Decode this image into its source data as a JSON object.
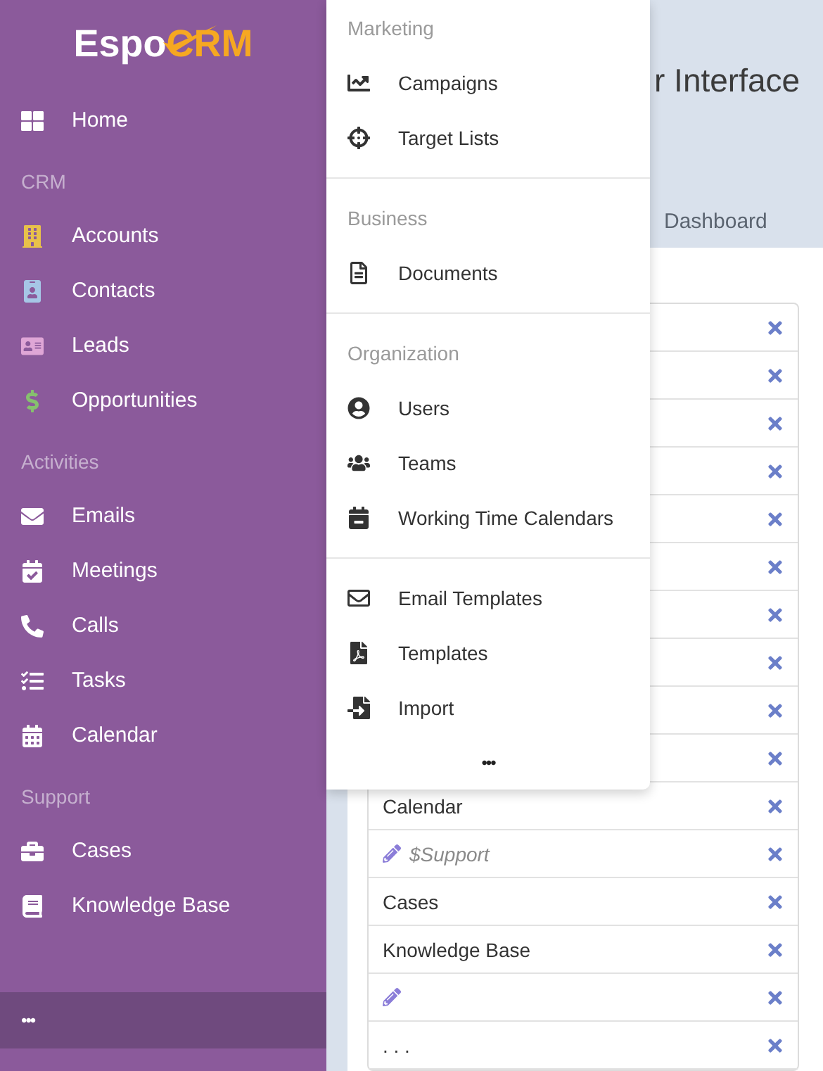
{
  "logo": {
    "text": "Espo",
    "accent": "CRM"
  },
  "sidebar": {
    "sections": [
      {
        "items": [
          {
            "label": "Home",
            "color": "#ffffff"
          }
        ]
      },
      {
        "header": "CRM",
        "items": [
          {
            "label": "Accounts",
            "color": "#e8c14a"
          },
          {
            "label": "Contacts",
            "color": "#a6c6e6"
          },
          {
            "label": "Leads",
            "color": "#dfa6d6"
          },
          {
            "label": "Opportunities",
            "color": "#86c06e"
          }
        ]
      },
      {
        "header": "Activities",
        "items": [
          {
            "label": "Emails",
            "color": "#ffffff"
          },
          {
            "label": "Meetings",
            "color": "#ffffff"
          },
          {
            "label": "Calls",
            "color": "#ffffff"
          },
          {
            "label": "Tasks",
            "color": "#ffffff"
          },
          {
            "label": "Calendar",
            "color": "#ffffff"
          }
        ]
      },
      {
        "header": "Support",
        "items": [
          {
            "label": "Cases",
            "color": "#ffffff"
          },
          {
            "label": "Knowledge Base",
            "color": "#ffffff"
          }
        ]
      }
    ],
    "more": "•••"
  },
  "menu": {
    "sections": [
      {
        "header": "Marketing",
        "items": [
          "Campaigns",
          "Target Lists"
        ]
      },
      {
        "header": "Business",
        "items": [
          "Documents"
        ]
      },
      {
        "header": "Organization",
        "items": [
          "Users",
          "Teams",
          "Working Time Calendars"
        ]
      },
      {
        "items": [
          "Email Templates",
          "Templates",
          "Import"
        ]
      }
    ],
    "more": "•••"
  },
  "header": {
    "title": "r Interface",
    "tab": "Dashboard"
  },
  "list": {
    "rows": [
      {
        "kind": "hidden"
      },
      {
        "kind": "hidden"
      },
      {
        "kind": "hidden"
      },
      {
        "kind": "hidden"
      },
      {
        "kind": "hidden"
      },
      {
        "kind": "hidden"
      },
      {
        "kind": "hidden"
      },
      {
        "kind": "hidden"
      },
      {
        "kind": "hidden"
      },
      {
        "kind": "hidden"
      },
      {
        "kind": "item",
        "label": "Calendar"
      },
      {
        "kind": "group",
        "label": "$Support"
      },
      {
        "kind": "item",
        "label": "Cases"
      },
      {
        "kind": "item",
        "label": "Knowledge Base"
      },
      {
        "kind": "group"
      },
      {
        "kind": "item",
        "label": ". . ."
      }
    ]
  }
}
